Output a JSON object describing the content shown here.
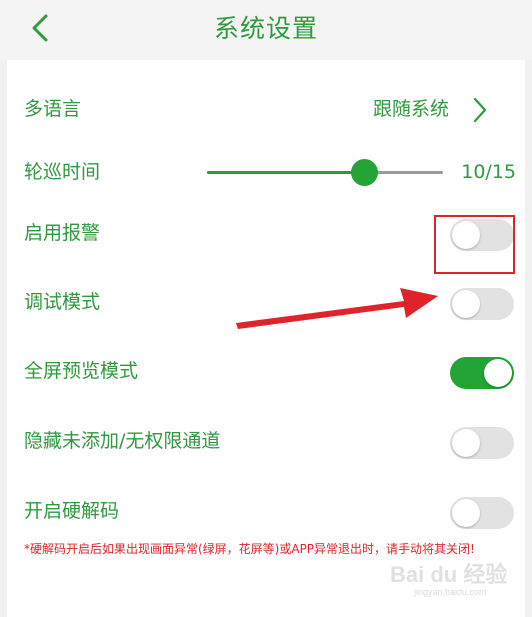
{
  "header": {
    "title": "系统设置"
  },
  "settings": {
    "language": {
      "label": "多语言",
      "value": "跟随系统"
    },
    "patrol": {
      "label": "轮巡时间",
      "value_text": "10/15",
      "value": 10,
      "max": 15
    },
    "alarm": {
      "label": "启用报警",
      "on": false
    },
    "debug": {
      "label": "调试模式",
      "on": false
    },
    "fullscreen": {
      "label": "全屏预览模式",
      "on": true
    },
    "hide_channels": {
      "label": "隐藏未添加/无权限通道",
      "on": false
    },
    "hw_decode": {
      "label": "开启硬解码",
      "on": false
    }
  },
  "note": "*硬解码开启后如果出现画面异常(绿屏，花屏等)或APP异常退出时，请手动将其关闭!",
  "watermark": {
    "logo": "Bai du 经验",
    "sub": "jingyan.baidu.com"
  },
  "colors": {
    "accent": "#2f9a3d",
    "toggle_on": "#22a436",
    "toggle_off": "#e2e2e2",
    "annotation": "#e0232b"
  }
}
